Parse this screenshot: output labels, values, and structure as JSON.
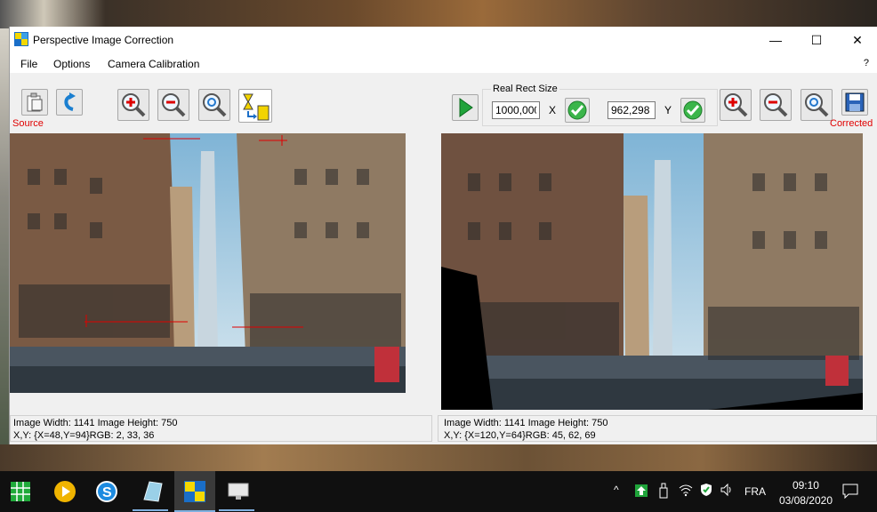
{
  "window": {
    "title": "Perspective Image Correction",
    "controls": {
      "minimize": "—",
      "maximize": "☐",
      "close": "✕"
    }
  },
  "menu": {
    "items": [
      "File",
      "Options",
      "Camera Calibration"
    ],
    "help": "?"
  },
  "toolbar": {
    "source_label": "Source",
    "corrected_label": "Corrected",
    "real_rect_title": "Real Rect Size",
    "x_value": "1000,000",
    "x_label": "X",
    "y_value": "962,298",
    "y_label": "Y"
  },
  "source_panel": {
    "size_text": "Image Width: 1141 Image Height: 750",
    "pixel_text": "X,Y: {X=48,Y=94}RGB: 2, 33, 36"
  },
  "corrected_panel": {
    "size_text": "Image Width: 1141 Image Height: 750",
    "pixel_text": "X,Y: {X=120,Y=64}RGB: 45, 62, 69"
  },
  "taskbar": {
    "language": "FRA",
    "time": "09:10",
    "date": "03/08/2020"
  },
  "colors": {
    "accent_red": "#e00000",
    "taskbar_bg": "#101010",
    "window_bg": "#f0f0f0"
  }
}
